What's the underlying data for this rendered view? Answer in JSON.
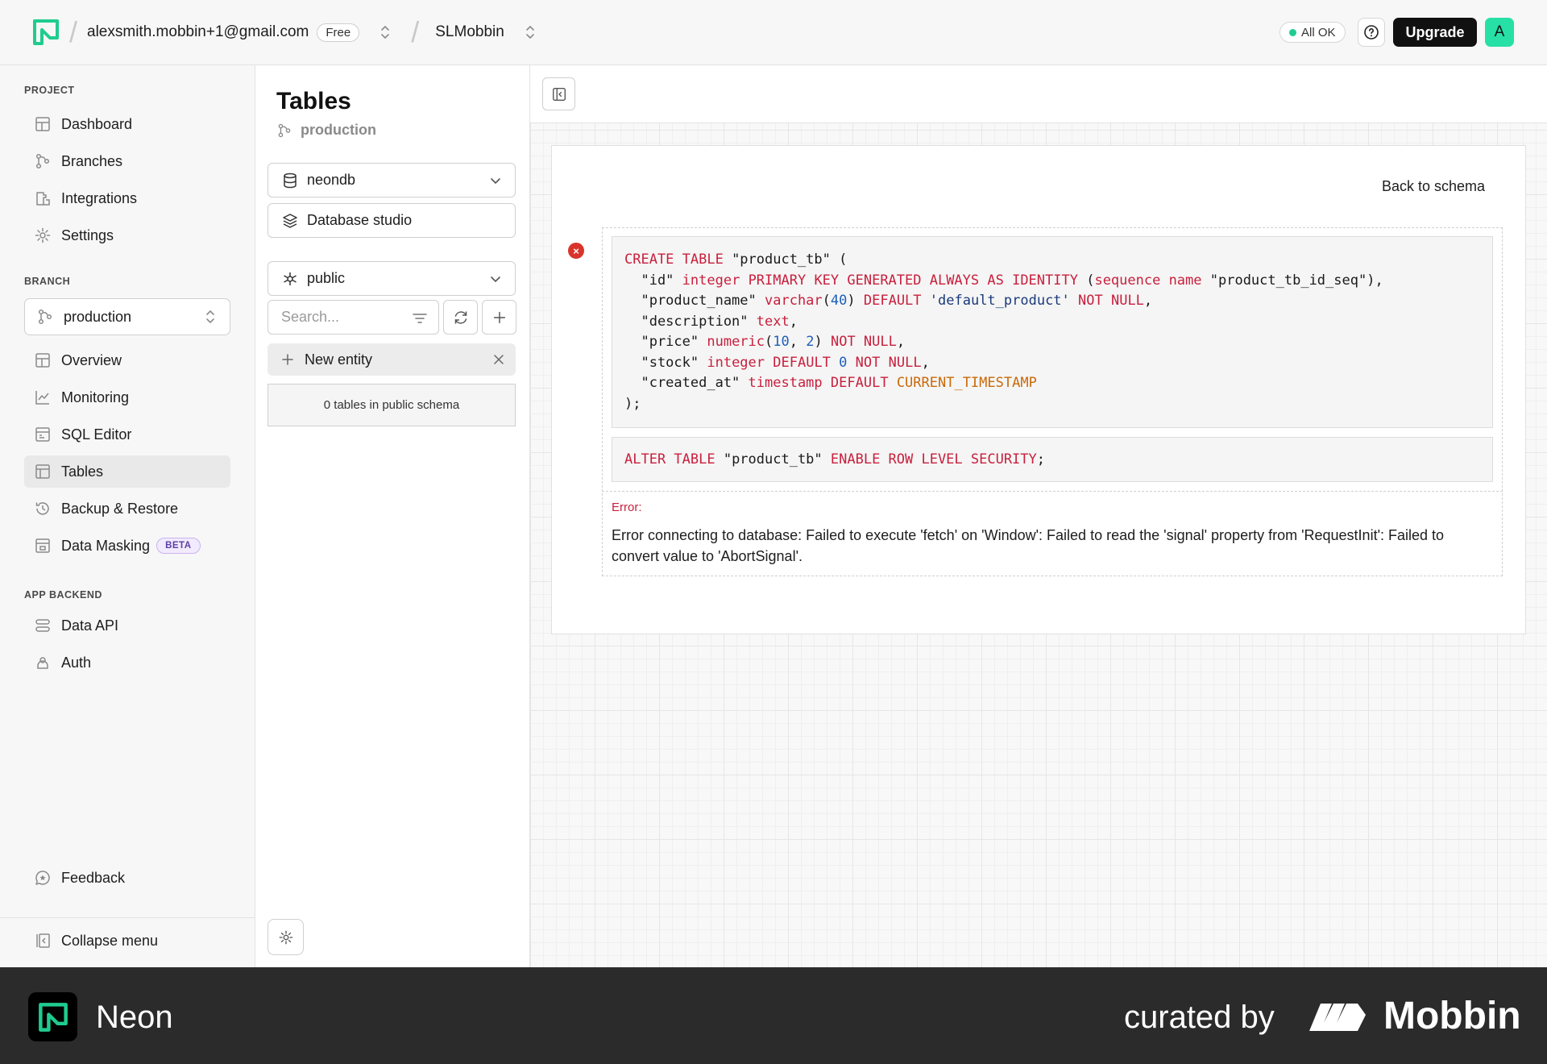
{
  "topbar": {
    "email": "alexsmith.mobbin+1@gmail.com",
    "plan": "Free",
    "project": "SLMobbin",
    "status": "All OK",
    "upgrade_label": "Upgrade",
    "avatar_initial": "A"
  },
  "sidebar": {
    "project_heading": "PROJECT",
    "project_items": [
      "Dashboard",
      "Branches",
      "Integrations",
      "Settings"
    ],
    "branch_heading": "BRANCH",
    "branch_selected": "production",
    "branch_items": [
      "Overview",
      "Monitoring",
      "SQL Editor",
      "Tables",
      "Backup & Restore",
      "Data Masking"
    ],
    "active_item": "Tables",
    "beta_label": "BETA",
    "backend_heading": "APP BACKEND",
    "backend_items": [
      "Data API",
      "Auth"
    ],
    "feedback_label": "Feedback",
    "collapse_label": "Collapse menu"
  },
  "tables_panel": {
    "title": "Tables",
    "branch": "production",
    "database": "neondb",
    "studio_label": "Database studio",
    "schema": "public",
    "search_placeholder": "Search...",
    "new_entity_label": "New entity",
    "count_text": "0 tables in public schema"
  },
  "main": {
    "back_label": "Back to schema",
    "error_label": "Error:",
    "error_message": "Error connecting to database: Failed to execute 'fetch' on 'Window': Failed to read the 'signal' property from 'RequestInit': Failed to convert value to 'AbortSignal'."
  },
  "footer": {
    "app_name": "Neon",
    "curated_by": "curated by",
    "brand": "Mobbin"
  },
  "colors": {
    "accent": "#27e0a5",
    "error": "#d9342b",
    "status_ok": "#1fcc8f"
  },
  "icons": [
    "neon-logo-icon",
    "updown-icon",
    "help-icon",
    "dashboard-icon",
    "branches-icon",
    "integrations-icon",
    "settings-icon",
    "overview-icon",
    "monitoring-icon",
    "sql-editor-icon",
    "tables-icon",
    "backup-icon",
    "data-masking-icon",
    "data-api-icon",
    "auth-icon",
    "feedback-icon",
    "collapse-icon",
    "database-icon",
    "studio-icon",
    "schema-icon",
    "chevron-down-icon",
    "filter-icon",
    "refresh-icon",
    "plus-icon",
    "close-icon",
    "gear-icon",
    "panel-collapse-icon",
    "error-icon"
  ]
}
